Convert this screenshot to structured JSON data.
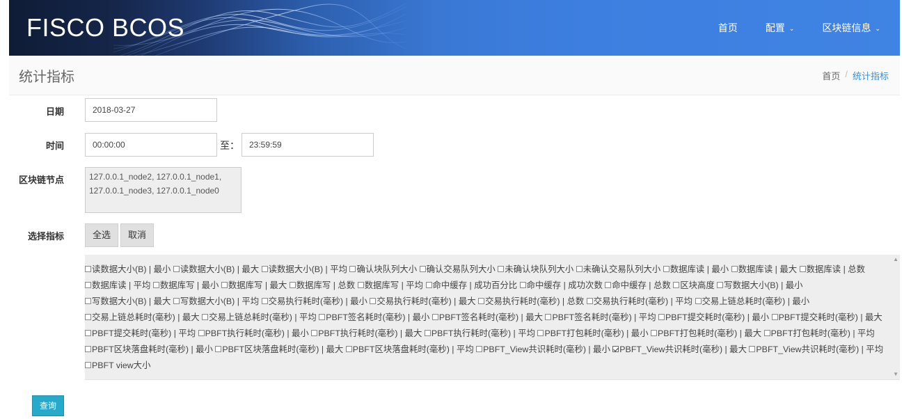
{
  "header": {
    "brand": "FISCO BCOS",
    "nav": [
      {
        "label": "首页",
        "has_dropdown": false
      },
      {
        "label": "配置",
        "has_dropdown": true
      },
      {
        "label": "区块链信息",
        "has_dropdown": true
      }
    ],
    "dropdown_icon": "chevron-down-icon"
  },
  "page": {
    "title": "统计指标",
    "breadcrumb": [
      {
        "label": "首页"
      },
      {
        "label": "统计指标"
      }
    ],
    "breadcrumb_separator": "/"
  },
  "form": {
    "date_label": "日期",
    "date_value": "2018-03-27",
    "time_label": "时间",
    "time_start": "00:00:00",
    "time_range_sep": "至：",
    "time_end": "23:59:59",
    "nodes_label": "区块链节点",
    "nodes_value": "127.0.0.1_node2, 127.0.0.1_node1, 127.0.0.1_node3, 127.0.0.1_node0",
    "metrics_label": "选择指标",
    "select_all": "全选",
    "cancel": "取消",
    "query": "查询"
  },
  "metrics": [
    {
      "label": "读数据大小(B) | 最小",
      "checked": false
    },
    {
      "label": "读数据大小(B) | 最大",
      "checked": false
    },
    {
      "label": "读数据大小(B) | 平均",
      "checked": false
    },
    {
      "label": "确认块队列大小",
      "checked": false
    },
    {
      "label": "确认交易队列大小",
      "checked": false
    },
    {
      "label": "未确认块队列大小",
      "checked": false
    },
    {
      "label": "未确认交易队列大小",
      "checked": false
    },
    {
      "label": "数据库读 | 最小",
      "checked": false
    },
    {
      "label": "数据库读 | 最大",
      "checked": false
    },
    {
      "label": "数据库读 | 总数",
      "checked": false
    },
    {
      "label": "数据库读 | 平均",
      "checked": false
    },
    {
      "label": "数据库写 | 最小",
      "checked": false
    },
    {
      "label": "数据库写 | 最大",
      "checked": false
    },
    {
      "label": "数据库写 | 总数",
      "checked": false
    },
    {
      "label": "数据库写 | 平均",
      "checked": false
    },
    {
      "label": "命中缓存 | 成功百分比",
      "checked": false
    },
    {
      "label": "命中缓存 | 成功次数",
      "checked": false
    },
    {
      "label": "命中缓存 | 总数",
      "checked": false
    },
    {
      "label": "区块高度",
      "checked": false
    },
    {
      "label": "写数据大小(B) | 最小",
      "checked": false
    },
    {
      "label": "写数据大小(B) | 最大",
      "checked": false
    },
    {
      "label": "写数据大小(B) | 平均",
      "checked": false
    },
    {
      "label": "交易执行耗时(毫秒) | 最小",
      "checked": false
    },
    {
      "label": "交易执行耗时(毫秒) | 最大",
      "checked": false
    },
    {
      "label": "交易执行耗时(毫秒) | 总数",
      "checked": false
    },
    {
      "label": "交易执行耗时(毫秒) | 平均",
      "checked": false
    },
    {
      "label": "交易上链总耗时(毫秒) | 最小",
      "checked": false
    },
    {
      "label": "交易上链总耗时(毫秒) | 最大",
      "checked": false
    },
    {
      "label": "交易上链总耗时(毫秒) | 平均",
      "checked": false
    },
    {
      "label": "PBFT签名耗时(毫秒) | 最小",
      "checked": false
    },
    {
      "label": "PBFT签名耗时(毫秒) | 最大",
      "checked": false
    },
    {
      "label": "PBFT签名耗时(毫秒) | 平均",
      "checked": false
    },
    {
      "label": "PBFT提交耗时(毫秒) | 最小",
      "checked": false
    },
    {
      "label": "PBFT提交耗时(毫秒) | 最大",
      "checked": false
    },
    {
      "label": "PBFT提交耗时(毫秒) | 平均",
      "checked": false
    },
    {
      "label": "PBFT执行耗时(毫秒) | 最小",
      "checked": false
    },
    {
      "label": "PBFT执行耗时(毫秒) | 最大",
      "checked": false
    },
    {
      "label": "PBFT执行耗时(毫秒) | 平均",
      "checked": false
    },
    {
      "label": "PBFT打包耗时(毫秒) | 最小",
      "checked": false
    },
    {
      "label": "PBFT打包耗时(毫秒) | 最大",
      "checked": false
    },
    {
      "label": "PBFT打包耗时(毫秒) | 平均",
      "checked": false
    },
    {
      "label": "PBFT区块落盘耗时(毫秒) | 最小",
      "checked": false
    },
    {
      "label": "PBFT区块落盘耗时(毫秒) | 最大",
      "checked": false
    },
    {
      "label": "PBFT区块落盘耗时(毫秒) | 平均",
      "checked": false
    },
    {
      "label": "PBFT_View共识耗时(毫秒) | 最小",
      "checked": false
    },
    {
      "label": "PBFT_View共识耗时(毫秒) | 最大",
      "checked": true
    },
    {
      "label": "PBFT_View共识耗时(毫秒) | 平均",
      "checked": false
    },
    {
      "label": "PBFT view大小",
      "checked": false
    }
  ],
  "icons": {
    "scroll_up": "scroll-up-arrow-icon",
    "scroll_down": "scroll-down-arrow-icon"
  },
  "colors": {
    "header_blue": "#3d7fe0",
    "header_dark": "#0f1c36",
    "breadcrumb_active": "#3a8fd6",
    "query_button": "#27a9c9",
    "metrics_bg": "#eeeeee"
  }
}
